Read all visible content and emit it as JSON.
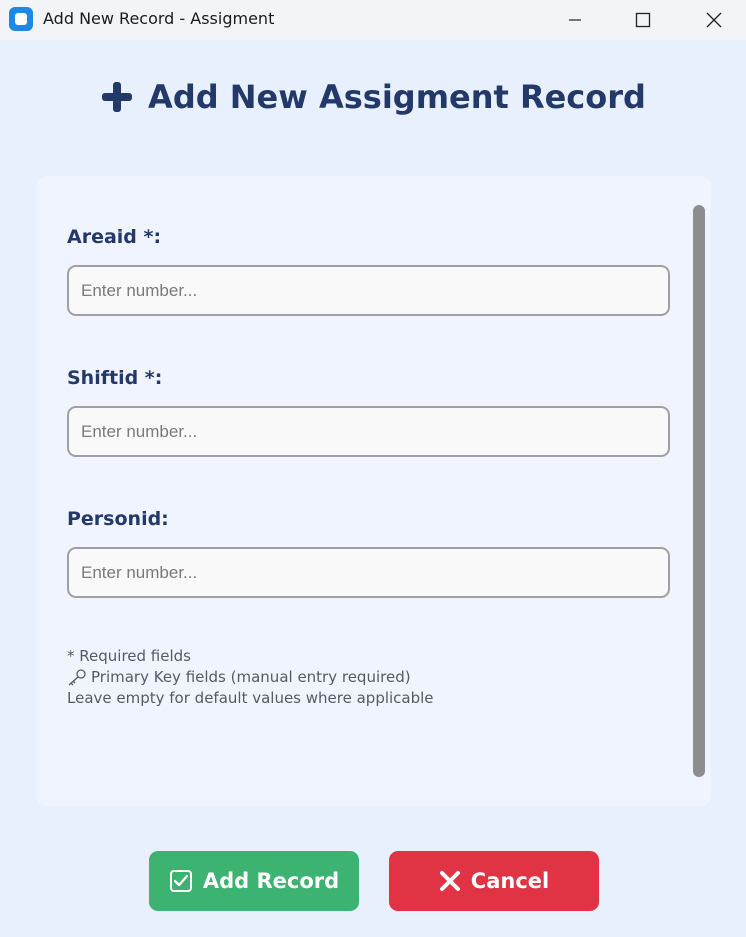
{
  "window": {
    "title": "Add New Record - Assigment"
  },
  "heading": {
    "icon": "plus-icon",
    "text": "Add New Assigment Record"
  },
  "fields": [
    {
      "label": "Areaid *:",
      "placeholder": "Enter number...",
      "value": ""
    },
    {
      "label": "Shiftid *:",
      "placeholder": "Enter number...",
      "value": ""
    },
    {
      "label": "Personid:",
      "placeholder": "Enter number...",
      "value": ""
    }
  ],
  "help": {
    "required": "* Required fields",
    "primary_key": "Primary Key fields (manual entry required)",
    "defaults": "Leave empty for default values where applicable"
  },
  "buttons": {
    "add": "Add Record",
    "cancel": "Cancel"
  },
  "colors": {
    "heading": "#23396a",
    "add_button": "#3cb370",
    "cancel_button": "#e03445",
    "background": "#e9f0fd"
  }
}
